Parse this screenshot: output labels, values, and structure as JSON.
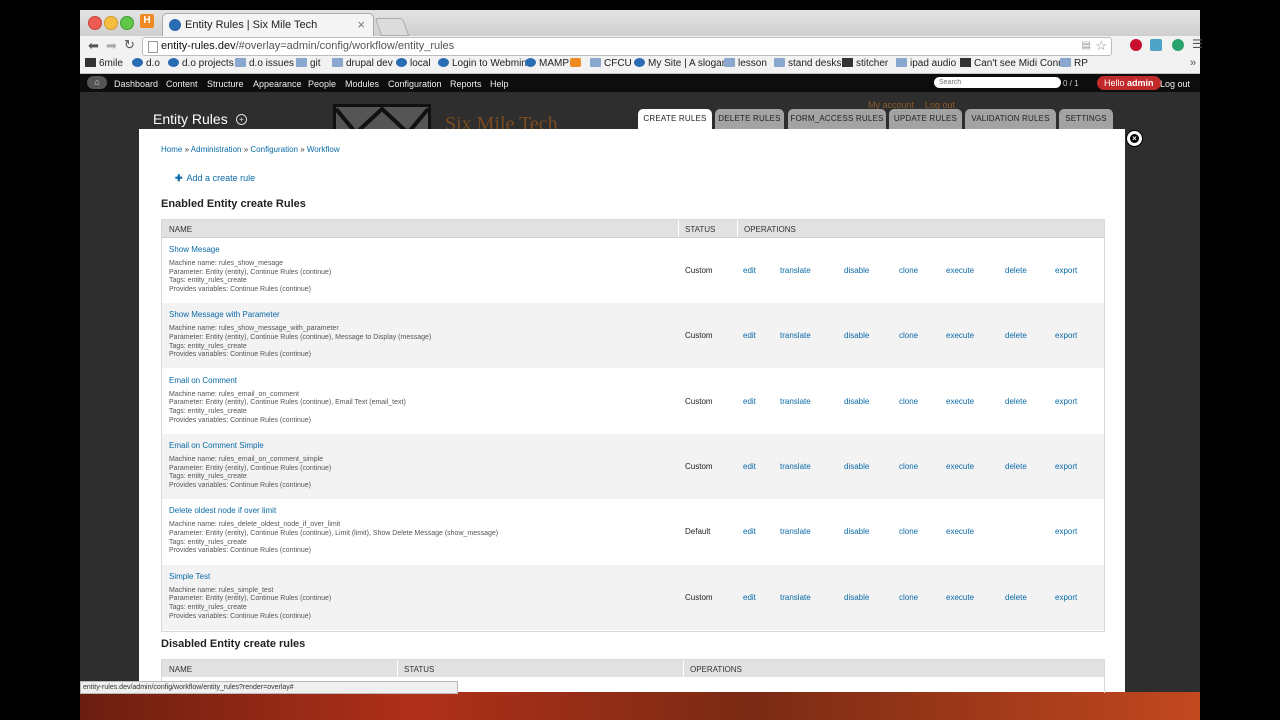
{
  "browser": {
    "tab_title": "Entity Rules | Six Mile Tech",
    "url_host": "entity-rules.dev",
    "url_path": "/#overlay=admin/config/workflow/entity_rules",
    "bookmarks": [
      "6mile",
      "d.o",
      "d.o projects",
      "d.o issues",
      "git",
      "drupal dev",
      "local",
      "Login to Webmin",
      "MAMP",
      "CFCU",
      "My Site | A slogan",
      "lesson",
      "stand desks",
      "stitcher",
      "ipad audio",
      "Can't see Midi Conn",
      "RP"
    ],
    "status_url": "entity-rules.dev/admin/config/workflow/entity_rules?render=overlay#"
  },
  "admin_toolbar": {
    "items": [
      "Dashboard",
      "Content",
      "Structure",
      "Appearance",
      "People",
      "Modules",
      "Configuration",
      "Reports",
      "Help"
    ],
    "search_placeholder": "Search",
    "counter": "0 / 1",
    "hello_prefix": "Hello ",
    "user": "admin",
    "logout": "Log out"
  },
  "site": {
    "name": "Six Mile Tech",
    "my_account": "My account",
    "logout": "Log out"
  },
  "overlay": {
    "title": "Entity Rules",
    "tabs": [
      {
        "label": "CREATE RULES",
        "active": true
      },
      {
        "label": "DELETE RULES",
        "active": false
      },
      {
        "label": "FORM_ACCESS RULES",
        "active": false
      },
      {
        "label": "UPDATE RULES",
        "active": false
      },
      {
        "label": "VALIDATION RULES",
        "active": false
      },
      {
        "label": "SETTINGS",
        "active": false
      }
    ],
    "breadcrumb": [
      "Home",
      "Administration",
      "Configuration",
      "Workflow"
    ],
    "add_link": "Add a create rule",
    "enabled_title": "Enabled Entity create Rules",
    "disabled_title": "Disabled Entity create rules",
    "headers": {
      "name": "NAME",
      "status": "STATUS",
      "operations": "OPERATIONS"
    },
    "rules": [
      {
        "title": "Show Mesage",
        "machine": "Machine name: rules_show_mesage",
        "parameter": "Parameter: Entity (entity), Continue Rules (continue)",
        "tags": "Tags: entity_rules_create",
        "provides": "Provides variables: Continue Rules (continue)",
        "status": "Custom",
        "ops": [
          "edit",
          "translate",
          "disable",
          "clone",
          "execute",
          "delete",
          "export"
        ]
      },
      {
        "title": "Show Message with Parameter",
        "machine": "Machine name: rules_show_message_with_parameter",
        "parameter": "Parameter: Entity (entity), Continue Rules (continue), Message to Display (message)",
        "tags": "Tags: entity_rules_create",
        "provides": "Provides variables: Continue Rules (continue)",
        "status": "Custom",
        "ops": [
          "edit",
          "translate",
          "disable",
          "clone",
          "execute",
          "delete",
          "export"
        ]
      },
      {
        "title": "Email on Comment",
        "machine": "Machine name: rules_email_on_comment",
        "parameter": "Parameter: Entity (entity), Continue Rules (continue), Email Text (email_text)",
        "tags": "Tags: entity_rules_create",
        "provides": "Provides variables: Continue Rules (continue)",
        "status": "Custom",
        "ops": [
          "edit",
          "translate",
          "disable",
          "clone",
          "execute",
          "delete",
          "export"
        ]
      },
      {
        "title": "Email on Comment Simple",
        "machine": "Machine name: rules_email_on_comment_simple",
        "parameter": "Parameter: Entity (entity), Continue Rules (continue)",
        "tags": "Tags: entity_rules_create",
        "provides": "Provides variables: Continue Rules (continue)",
        "status": "Custom",
        "ops": [
          "edit",
          "translate",
          "disable",
          "clone",
          "execute",
          "delete",
          "export"
        ]
      },
      {
        "title": "Delete oldest node if over limit",
        "machine": "Machine name: rules_delete_oldest_node_if_over_limit",
        "parameter": "Parameter: Entity (entity), Continue Rules (continue), Limit (limit), Show Delete Message (show_message)",
        "tags": "Tags: entity_rules_create",
        "provides": "Provides variables: Continue Rules (continue)",
        "status": "Default",
        "ops": [
          "edit",
          "translate",
          "disable",
          "clone",
          "execute",
          "",
          "export"
        ]
      },
      {
        "title": "Simple Test",
        "machine": "Machine name: rules_simple_test",
        "parameter": "Parameter: Entity (entity), Continue Rules (continue)",
        "tags": "Tags: entity_rules_create",
        "provides": "Provides variables: Continue Rules (continue)",
        "status": "Custom",
        "ops": [
          "edit",
          "translate",
          "disable",
          "clone",
          "execute",
          "delete",
          "export"
        ]
      }
    ]
  }
}
